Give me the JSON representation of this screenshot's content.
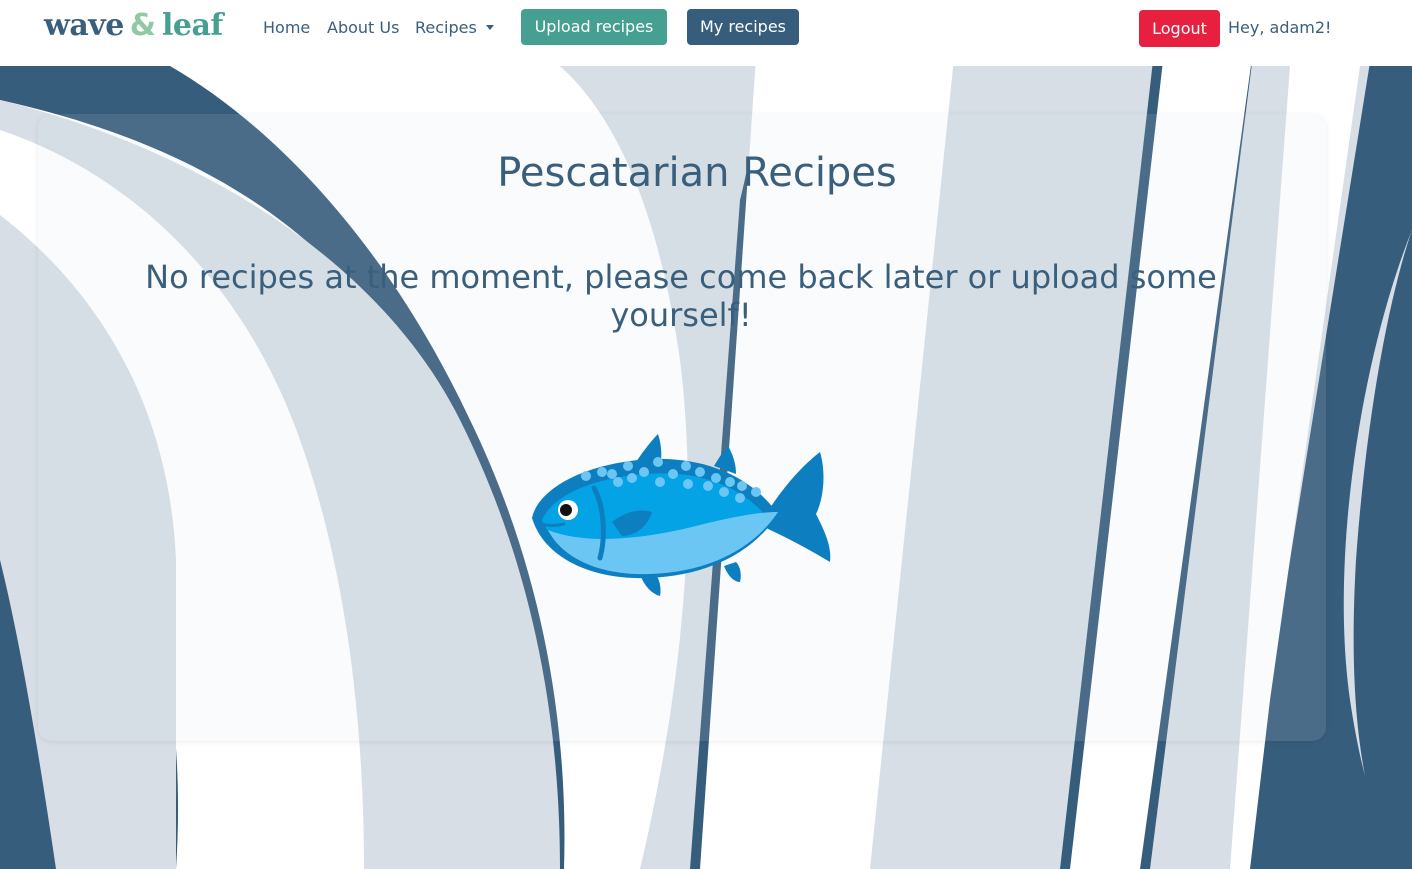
{
  "brand": {
    "logo_word_1": "wave",
    "logo_amp": "&",
    "logo_word_2": "leaf",
    "colors": {
      "primary_blue": "#3a5f7d",
      "teal": "#45a091",
      "leaf_green": "#8fc9a6",
      "danger_red": "#e8203f",
      "bg_stripe_light": "#d7dee5",
      "bg_stripe_dark": "#375d7d"
    }
  },
  "nav": {
    "home": "Home",
    "about": "About Us",
    "recipes": "Recipes",
    "upload": "Upload recipes",
    "my_recipes": "My recipes",
    "logout": "Logout",
    "greeting": "Hey, adam2!"
  },
  "main": {
    "title": "Pescatarian Recipes",
    "empty_message": "No recipes at the moment, please come back later or upload some yourself!",
    "illustration_icon": "fish-icon"
  }
}
